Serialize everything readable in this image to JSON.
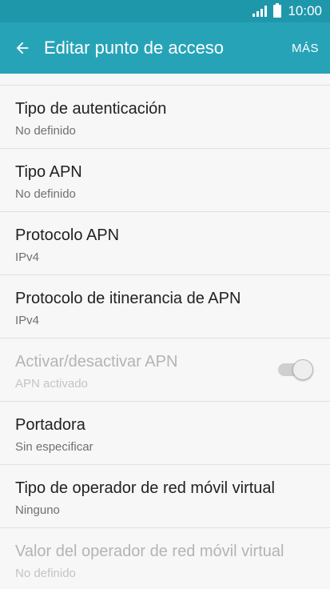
{
  "status_bar": {
    "time": "10:00",
    "icons": [
      "signal-icon",
      "battery-icon"
    ]
  },
  "app_bar": {
    "title": "Editar punto de acceso",
    "more_label": "MÁS",
    "back_icon": "arrow-left-icon",
    "color": "#27a3b8"
  },
  "items": [
    {
      "label": "Tipo de autenticación",
      "value": "No definido"
    },
    {
      "label": "Tipo APN",
      "value": "No definido"
    },
    {
      "label": "Protocolo APN",
      "value": "IPv4"
    },
    {
      "label": "Protocolo de itinerancia de APN",
      "value": "IPv4"
    },
    {
      "label": "Activar/desactivar APN",
      "value": "APN activado",
      "toggle_on": true,
      "disabled": true
    },
    {
      "label": "Portadora",
      "value": "Sin especificar"
    },
    {
      "label": "Tipo de operador de red móvil virtual",
      "value": "Ninguno"
    },
    {
      "label": "Valor del operador de red móvil virtual",
      "value": "No definido",
      "disabled": true
    }
  ]
}
